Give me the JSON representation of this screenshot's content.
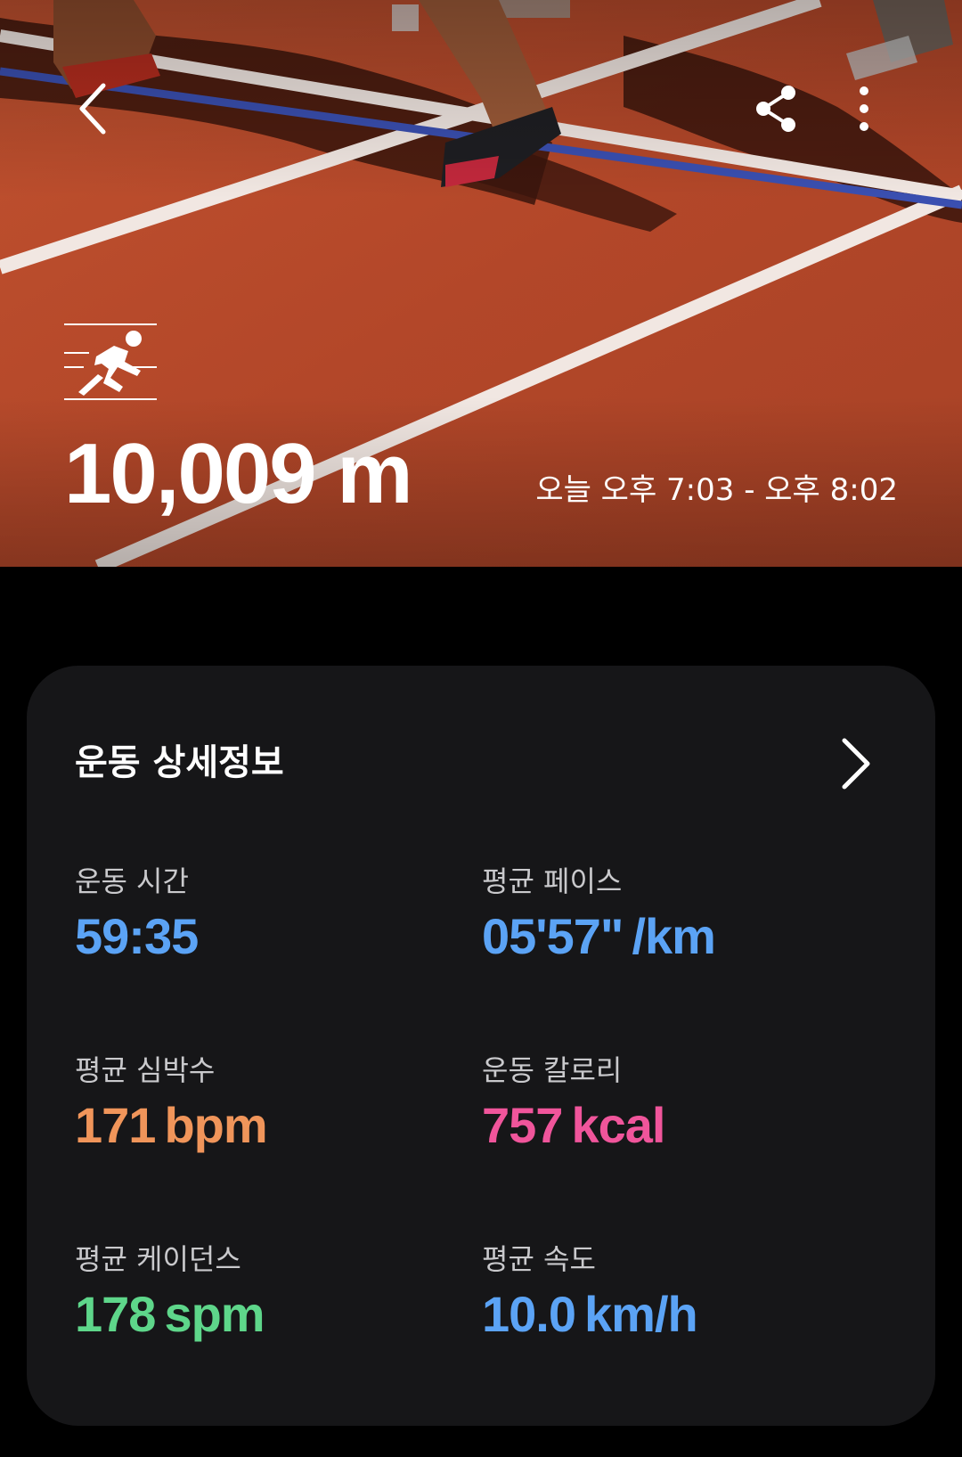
{
  "hero": {
    "distance": "10,009 m",
    "time_range": "오늘 오후 7:03 - 오후 8:02",
    "activity_icon": "running-icon",
    "track_color": "#b54a2e"
  },
  "top_bar": {
    "back_icon": "back-arrow-icon",
    "share_icon": "share-icon",
    "more_icon": "more-vertical-icon"
  },
  "details": {
    "title": "운동 상세정보",
    "chevron_icon": "chevron-right-icon",
    "metrics": [
      {
        "label": "운동 시간",
        "value": "59:35",
        "unit": "",
        "color": "#5ba3f5"
      },
      {
        "label": "평균 페이스",
        "value": "05'57\"",
        "unit": "/km",
        "color": "#5ba3f5"
      },
      {
        "label": "평균 심박수",
        "value": "171",
        "unit": "bpm",
        "color": "#f0955a"
      },
      {
        "label": "운동 칼로리",
        "value": "757",
        "unit": "kcal",
        "color": "#f0559b"
      },
      {
        "label": "평균 케이던스",
        "value": "178",
        "unit": "spm",
        "color": "#5ed68a"
      },
      {
        "label": "평균 속도",
        "value": "10.0",
        "unit": "km/h",
        "color": "#5ba3f5"
      }
    ]
  },
  "colors": {
    "background": "#000000",
    "card": "#161618",
    "label": "#c9c9cc"
  }
}
